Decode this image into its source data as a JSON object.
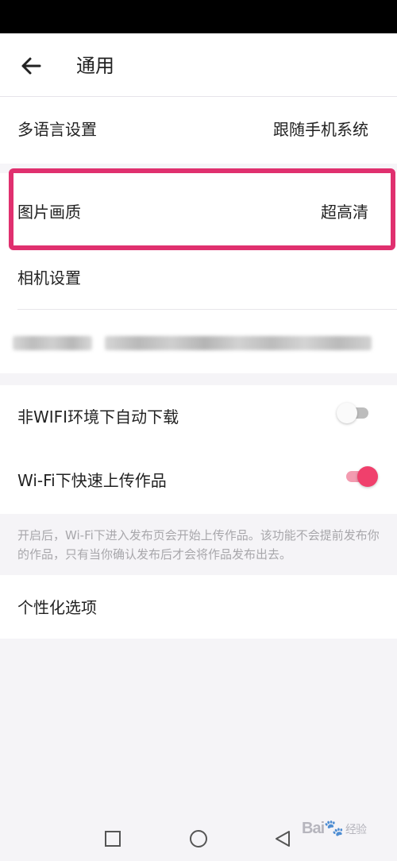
{
  "header": {
    "title": "通用"
  },
  "settings": {
    "language": {
      "label": "多语言设置",
      "value": "跟随手机系统"
    },
    "image_quality": {
      "label": "图片画质",
      "value": "超高清"
    },
    "camera": {
      "label": "相机设置"
    }
  },
  "network": {
    "auto_download": {
      "label": "非WIFI环境下自动下载",
      "enabled": false
    },
    "wifi_upload": {
      "label": "Wi-Fi下快速上传作品",
      "enabled": true
    },
    "note": "开启后，Wi-Fi下进入发布页会开始上传作品。该功能不会提前发布你的作品，只有当你确认发布后才会将作品发布出去。"
  },
  "personalization": {
    "label": "个性化选项"
  },
  "watermark": {
    "brand": "Bai",
    "paw": "🐾",
    "text": "经验"
  },
  "colors": {
    "accent": "#f0406c",
    "highlight_border": "#e0306f",
    "background": "#f5f4f7"
  },
  "icons": {
    "back": "arrow-left-icon",
    "nav_recent": "square-icon",
    "nav_home": "circle-icon",
    "nav_back": "triangle-back-icon"
  }
}
